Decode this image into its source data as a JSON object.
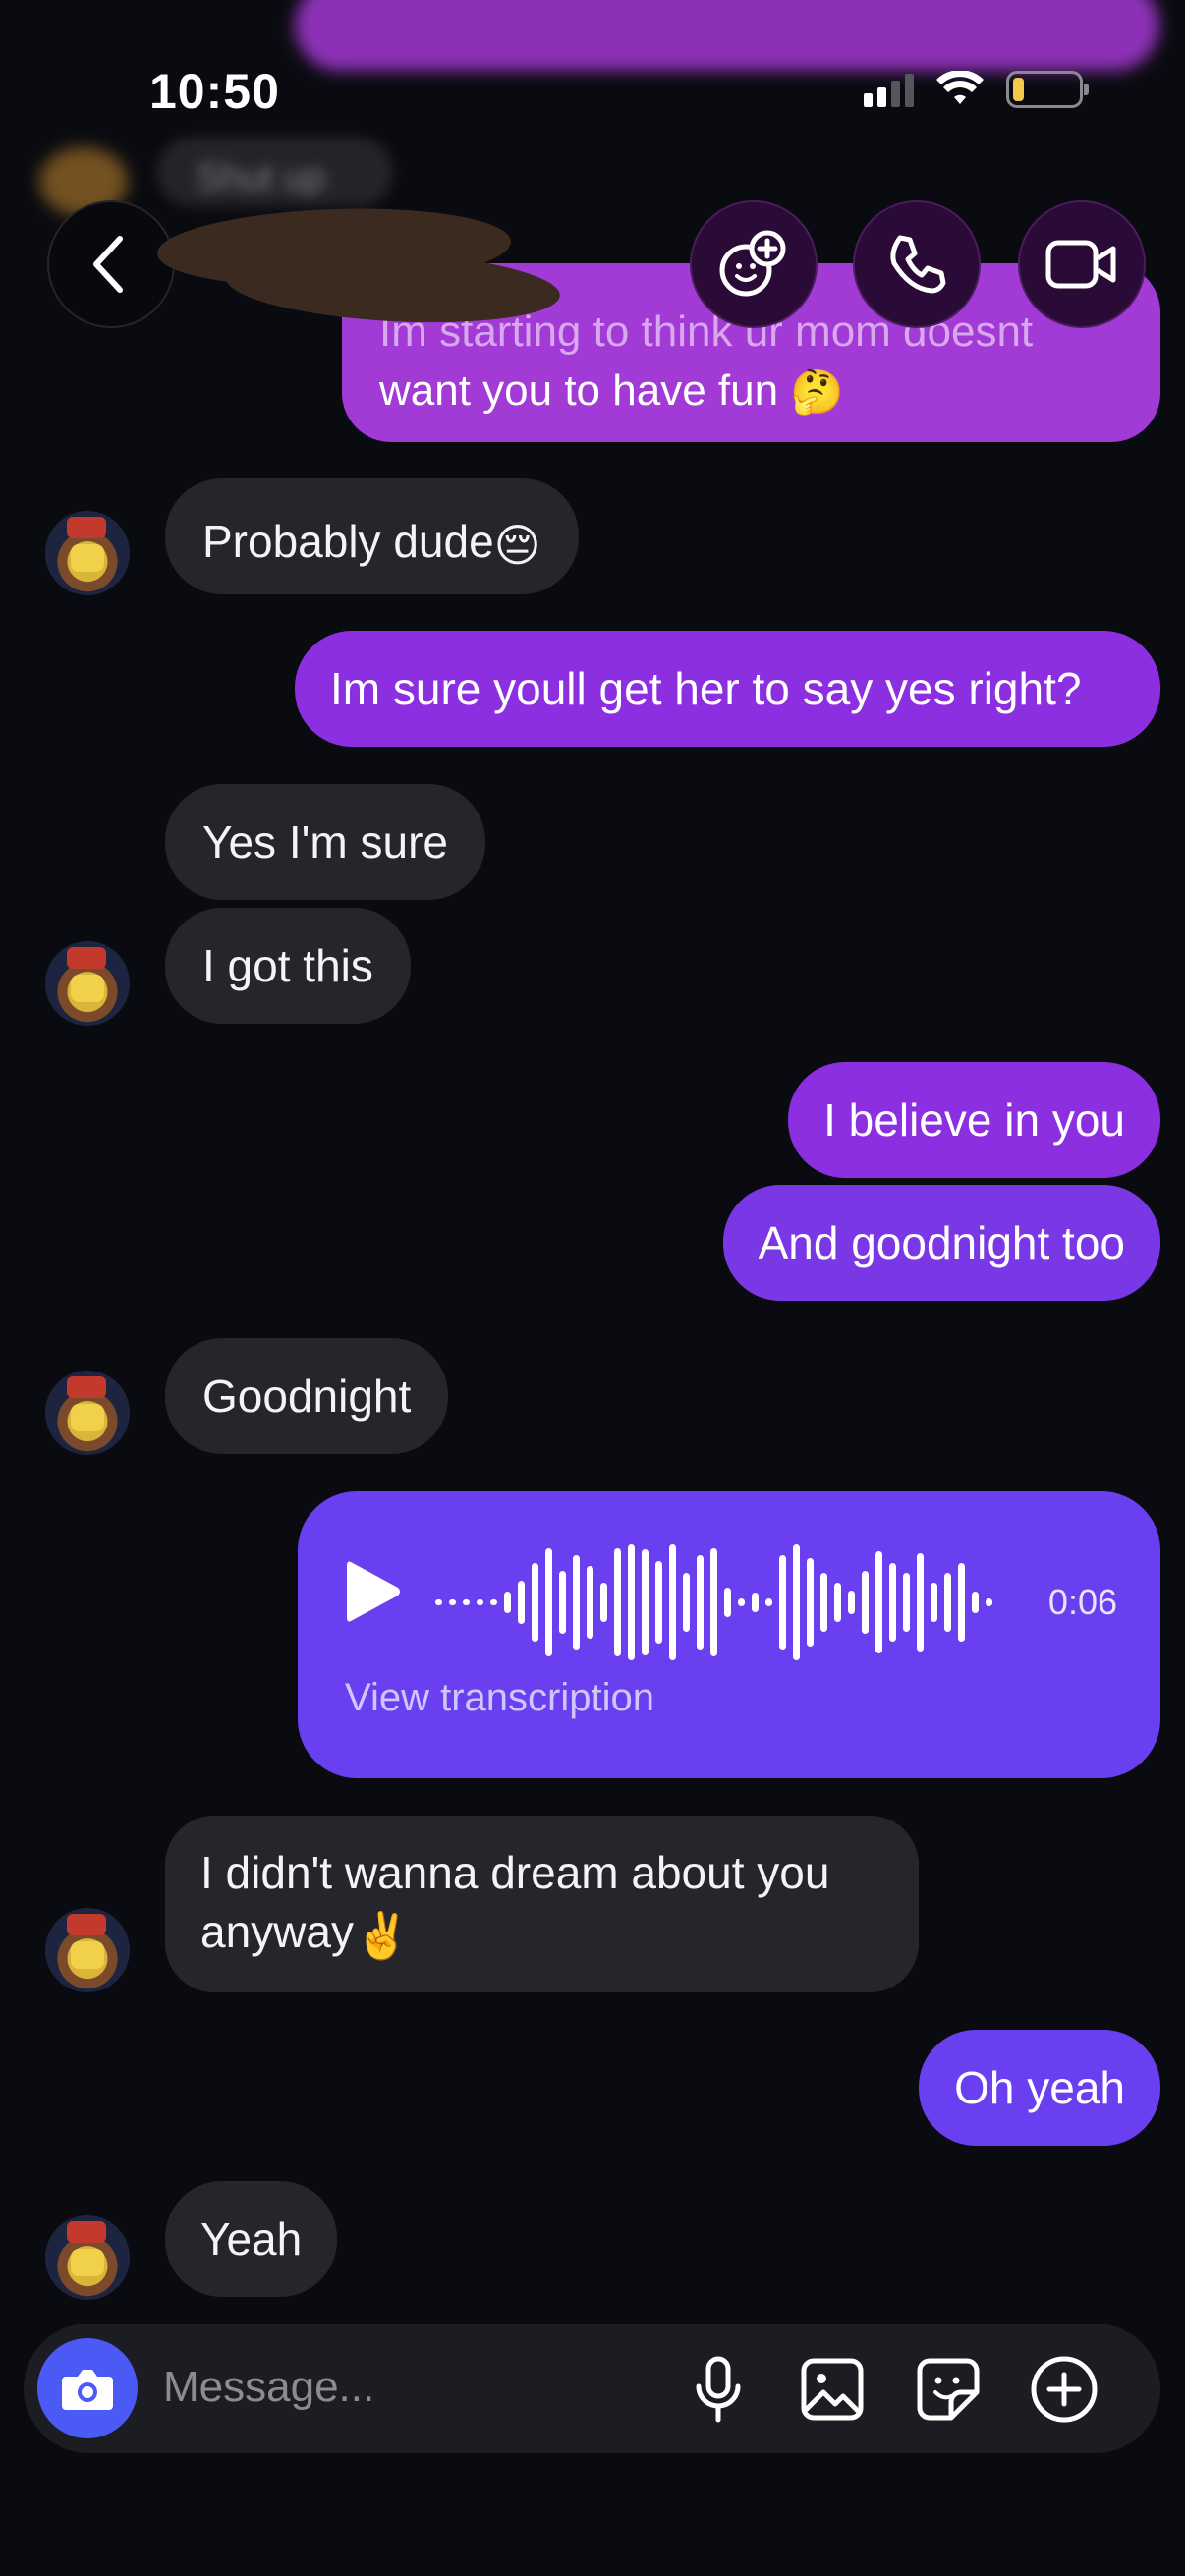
{
  "status_bar": {
    "time": "10:50"
  },
  "header": {
    "contact_name": ""
  },
  "background_previews": {
    "partial_message": "Shut up"
  },
  "messages": [
    {
      "sender": "me",
      "text": "Im starting to think ur mom doesnt",
      "text2": "want you to have fun",
      "emoji": "🤔"
    },
    {
      "sender": "them",
      "text": "Probably dude",
      "emoji": "😔"
    },
    {
      "sender": "me",
      "text": "Im sure youll get her to say yes right?"
    },
    {
      "sender": "them",
      "text": "Yes I'm sure"
    },
    {
      "sender": "them",
      "text": "I got this"
    },
    {
      "sender": "me",
      "text": "I believe in you"
    },
    {
      "sender": "me",
      "text": "And goodnight too"
    },
    {
      "sender": "them",
      "text": "Goodnight"
    },
    {
      "sender": "me",
      "type": "voice",
      "duration": "0:06",
      "transcription_label": "View transcription"
    },
    {
      "sender": "them",
      "text": "I didn't wanna dream about you",
      "text2": "anyway",
      "emoji": "✌️"
    },
    {
      "sender": "me",
      "text": "Oh yeah"
    },
    {
      "sender": "them",
      "text": "Yeah"
    }
  ],
  "composer": {
    "placeholder": "Message..."
  },
  "colors": {
    "background": "#0a0b10",
    "their_bubble": "#25262b",
    "my_bubble_pink": "#a23ad6",
    "my_bubble_blue": "#6a3ff0",
    "camera_button": "#4b59f5"
  },
  "icons": {
    "back": "chevron-left-icon",
    "effects": "face-plus-icon",
    "call": "phone-icon",
    "video": "video-camera-icon",
    "camera": "camera-icon",
    "mic": "microphone-icon",
    "gallery": "image-icon",
    "sticker": "sticker-icon",
    "more": "plus-circle-icon"
  }
}
